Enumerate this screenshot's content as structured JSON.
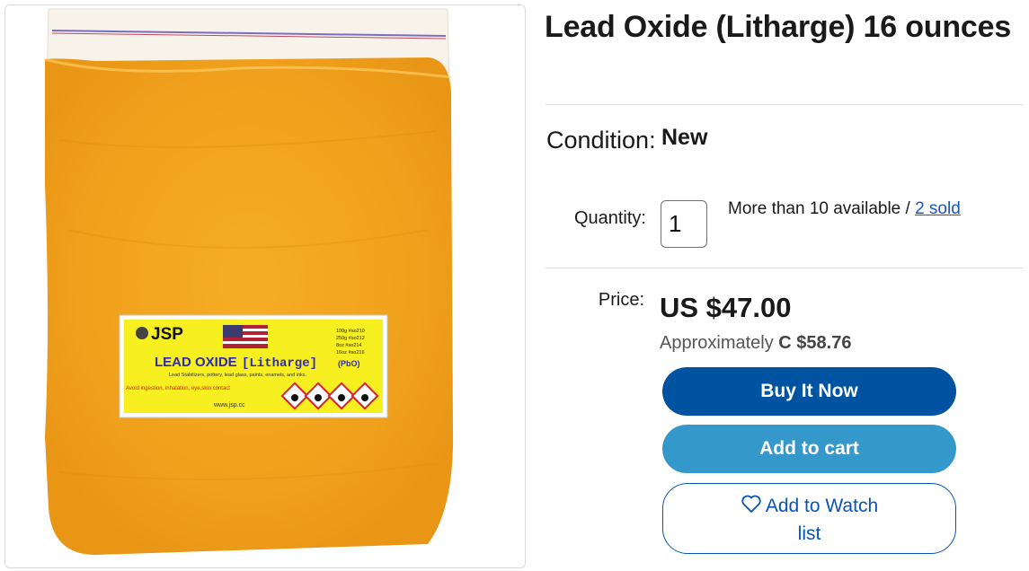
{
  "product": {
    "title": "Lead Oxide (Litharge) 16 ounces",
    "image_alt": "Bag of orange lead oxide powder with JSP label",
    "label": {
      "brand": "JSP",
      "name": "LEAD OXIDE",
      "name_sub": "[Litharge]",
      "formula": "(PbO)",
      "uses": "Lead Stabilizers, pottery, lead glass, paints, enamels, and inks.",
      "warning": "Avoid ingestion, inhalation, eye,skin contact",
      "website": "www.jsp.cc",
      "sizes": [
        "100g #so210",
        "250g #so212",
        "8oz #so214",
        "16oz #so216"
      ]
    }
  },
  "details": {
    "condition_label": "Condition:",
    "condition_value": "New",
    "quantity_label": "Quantity:",
    "quantity_value": "1",
    "availability": "More than 10 available / ",
    "sold_link": "2 sold",
    "price_label": "Price:",
    "price_value": "US $47.00",
    "approx_prefix": "Approximately ",
    "approx_value": "C $58.76"
  },
  "buttons": {
    "buy_now": "Buy It Now",
    "add_to_cart": "Add to cart",
    "watch_line1": "Add to Watch",
    "watch_line2": "list"
  },
  "colors": {
    "buy_now_bg": "#0053a0",
    "cart_bg": "#3498ca",
    "link": "#1c55b8",
    "powder": "#f2a51c"
  }
}
